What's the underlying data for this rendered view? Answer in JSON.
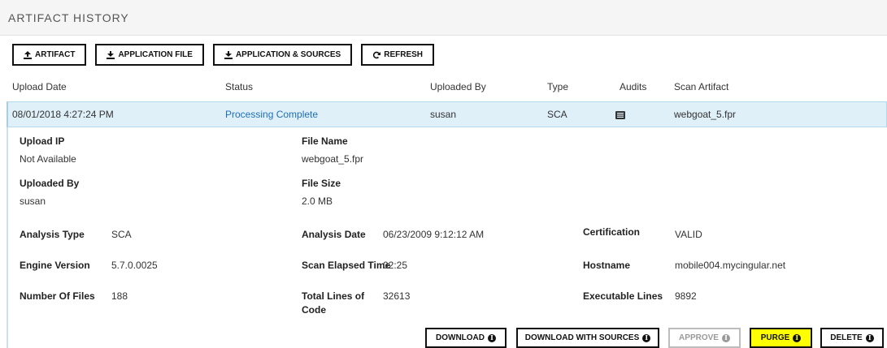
{
  "panel": {
    "title": "ARTIFACT HISTORY"
  },
  "toolbar": {
    "artifact": "ARTIFACT",
    "application_file": "APPLICATION FILE",
    "application_sources": "APPLICATION & SOURCES",
    "refresh": "REFRESH"
  },
  "columns": {
    "upload_date": "Upload Date",
    "status": "Status",
    "uploaded_by": "Uploaded By",
    "type": "Type",
    "audits": "Audits",
    "scan_artifact": "Scan Artifact"
  },
  "row": {
    "upload_date": "08/01/2018 4:27:24 PM",
    "status": "Processing Complete",
    "uploaded_by": "susan",
    "type": "SCA",
    "scan_artifact": "webgoat_5.fpr"
  },
  "details": {
    "upload_ip_label": "Upload IP",
    "upload_ip": "Not Available",
    "file_name_label": "File Name",
    "file_name": "webgoat_5.fpr",
    "uploaded_by_label": "Uploaded By",
    "uploaded_by": "susan",
    "file_size_label": "File Size",
    "file_size": "2.0 MB",
    "analysis_type_label": "Analysis Type",
    "analysis_type": "SCA",
    "analysis_date_label": "Analysis Date",
    "analysis_date": "06/23/2009 9:12:12 AM",
    "certification_label": "Certification",
    "certification": "VALID",
    "engine_version_label": "Engine Version",
    "engine_version": "5.7.0.0025",
    "scan_elapsed_label": "Scan Elapsed Time",
    "scan_elapsed": "02:25",
    "hostname_label": "Hostname",
    "hostname": "mobile004.mycingular.net",
    "num_files_label": "Number Of Files",
    "num_files": "188",
    "total_lines_label_1": "Total Lines of",
    "total_lines_label_2": "Code",
    "total_lines": "32613",
    "exec_lines_label": "Executable Lines",
    "exec_lines": "9892"
  },
  "actions": {
    "download": "DOWNLOAD",
    "download_sources": "DOWNLOAD WITH SOURCES",
    "approve": "APPROVE",
    "purge": "PURGE",
    "delete": "DELETE"
  },
  "colors": {
    "selected_row_bg": "#dff0f8",
    "link": "#1f6fb8",
    "highlight": "#ffff00"
  },
  "icons": [
    "upload-icon",
    "download-icon",
    "refresh-icon",
    "audits-list-icon",
    "info-icon"
  ]
}
